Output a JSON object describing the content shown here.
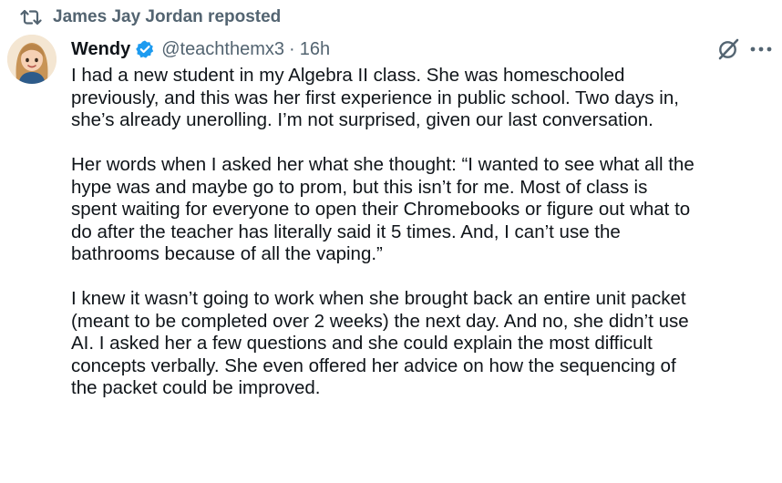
{
  "repost": {
    "label": "James Jay Jordan reposted",
    "icon": "repost-icon"
  },
  "author": {
    "name": "Wendy",
    "handle": "@teachthemx3",
    "separator": "·",
    "time": "16h",
    "verified": true,
    "verified_color": "#1d9bf0",
    "avatar_icon": "avatar-cartoon-woman"
  },
  "actions": {
    "grok_icon": "grok-icon",
    "more_icon": "more-options-icon"
  },
  "tweet": {
    "paragraph1": [
      "I had a new student in my Algebra II class. She was homeschooled",
      "previously, and this was her first experience in public school. Two days in,",
      "she’s already unerolling. I’m not surprised, given our last conversation."
    ],
    "paragraph2": [
      "Her words when I asked her what she thought: “I wanted to see what all the",
      "hype was and maybe go to prom, but this isn’t for me. Most of class is",
      "spent waiting for everyone to open their Chromebooks or figure out what to",
      "do after the teacher has literally said it 5 times. And, I can’t use the",
      "bathrooms because of all the vaping.”"
    ],
    "paragraph3": [
      "I knew it wasn’t going to work when she brought back an entire unit packet",
      "(meant to be completed over 2 weeks) the next day. And no, she didn’t use",
      "AI. I asked her a few questions and she could explain the most difficult",
      "concepts verbally. She even offered her advice on how the sequencing of",
      "the packet could be improved."
    ]
  }
}
